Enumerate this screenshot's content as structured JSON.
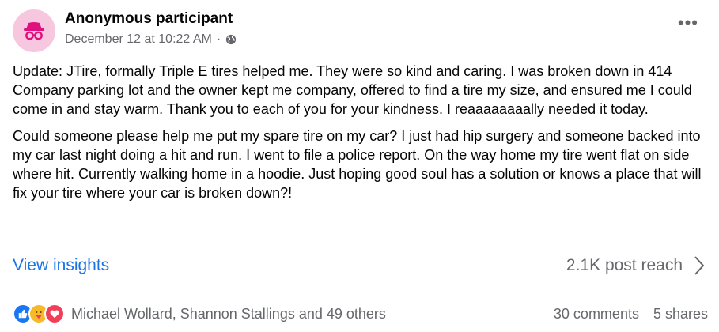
{
  "post": {
    "author": "Anonymous participant",
    "timestamp": "December 12 at 10:22 AM",
    "separator": "·",
    "audience_icon": "globe-icon",
    "avatar_icon": "incognito-icon",
    "more_icon": "more-options-icon",
    "more_label": "•••",
    "body": [
      "Update: JTire, formally Triple E tires helped me. They were so kind and caring. I was broken down in 414 Company parking lot and the owner kept me company, offered to find a tire my size, and ensured me I could come in and stay warm. Thank you to each of you for your kindness. I reaaaaaaaally needed it today.",
      "Could someone please help me put my spare tire on my car? I just had hip surgery and someone backed into my car last night doing a hit and run. I went to file a police report. On the way home my tire went flat on side where hit. Currently walking home in a hoodie. Just hoping good soul has a solution or knows a place that will fix your tire where your car is broken down?!"
    ]
  },
  "insights": {
    "link_label": "View insights",
    "reach_label": "2.1K post reach",
    "chevron_icon": "chevron-right-icon"
  },
  "footer": {
    "reactions": [
      "like-icon",
      "care-icon",
      "love-icon"
    ],
    "reactors": "Michael Wollard, Shannon Stallings and 49 others",
    "comments": "30 comments",
    "shares": "5 shares"
  },
  "colors": {
    "link": "#1b74e4",
    "secondary_text": "#65676b",
    "avatar_bg": "#f6c7df",
    "avatar_fg": "#e0117f",
    "like": "#1877f2",
    "care": "#f7b928",
    "love": "#f33e58"
  }
}
